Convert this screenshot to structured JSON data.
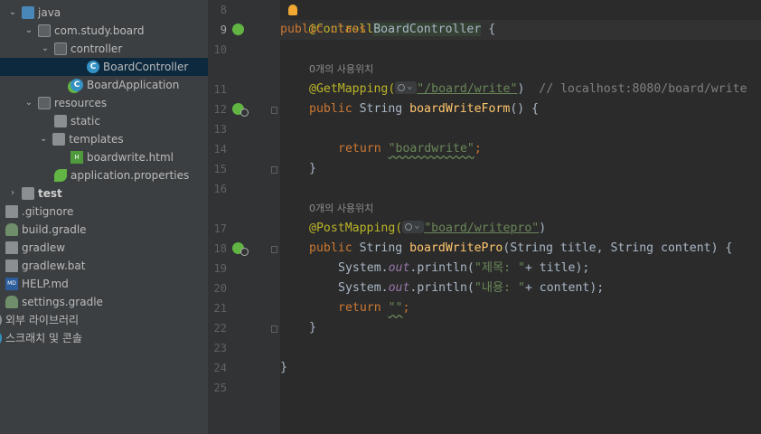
{
  "project_tree": [
    {
      "label": "java",
      "icon": "folder-icon",
      "selected": false,
      "bold": false
    },
    {
      "label": "com.study.board",
      "icon": "package-icon",
      "selected": false,
      "bold": false
    },
    {
      "label": "controller",
      "icon": "package-icon",
      "selected": false,
      "bold": false
    },
    {
      "label": "BoardController",
      "icon": "java-class-icon",
      "selected": true,
      "bold": false
    },
    {
      "label": "BoardApplication",
      "icon": "spring-boot-app-icon",
      "selected": false,
      "bold": false
    },
    {
      "label": "resources",
      "icon": "resources-folder-icon",
      "selected": false,
      "bold": false
    },
    {
      "label": "static",
      "icon": "folder-icon",
      "selected": false,
      "bold": false
    },
    {
      "label": "templates",
      "icon": "folder-icon",
      "selected": false,
      "bold": false
    },
    {
      "label": "boardwrite.html",
      "icon": "html-file-icon",
      "selected": false,
      "bold": false
    },
    {
      "label": "application.properties",
      "icon": "spring-properties-icon",
      "selected": false,
      "bold": false
    },
    {
      "label": "test",
      "icon": "folder-icon",
      "selected": false,
      "bold": true
    },
    {
      "label": ".gitignore",
      "icon": "gitignore-file-icon",
      "selected": false,
      "bold": false
    },
    {
      "label": "build.gradle",
      "icon": "gradle-icon",
      "selected": false,
      "bold": false
    },
    {
      "label": "gradlew",
      "icon": "terminal-file-icon",
      "selected": false,
      "bold": false
    },
    {
      "label": "gradlew.bat",
      "icon": "bat-file-icon",
      "selected": false,
      "bold": false
    },
    {
      "label": "HELP.md",
      "icon": "markdown-file-icon",
      "selected": false,
      "bold": false
    },
    {
      "label": "settings.gradle",
      "icon": "gradle-icon",
      "selected": false,
      "bold": false
    },
    {
      "label": "외부 라이브러리",
      "icon": "library-icon",
      "selected": false,
      "bold": false
    },
    {
      "label": "스크래치 및 콘솔",
      "icon": "scratch-icon",
      "selected": false,
      "bold": false
    }
  ],
  "editor": {
    "line_numbers": [
      "8",
      "9",
      "10",
      "11",
      "12",
      "13",
      "14",
      "15",
      "16",
      "17",
      "18",
      "19",
      "20",
      "21",
      "22",
      "23",
      "24",
      "25"
    ],
    "current_line": "9",
    "usage_hint_1": "0개의 사용위치",
    "usage_hint_2": "0개의 사용위치",
    "code": {
      "l8_ann": "@Controller",
      "l9_kw": "public class ",
      "l9_cls": "BoardController",
      "l9_rest": " {",
      "l11_ann": "@GetMapping(",
      "l11_path": "\"/board/write\"",
      "l11_close": ")",
      "l11_comment": "// localhost:8080/board/write",
      "l12_kw": "public ",
      "l12_type": "String ",
      "l12_fn": "boardWriteForm",
      "l12_rest": "() {",
      "l14_kw": "return ",
      "l14_str": "\"boardwrite\"",
      "l14_semi": ";",
      "l15_brace": "}",
      "l17_ann": "@PostMapping(",
      "l17_path": "\"board/writepro\"",
      "l17_close": ")",
      "l18_kw": "public ",
      "l18_type": "String ",
      "l18_fn": "boardWritePro",
      "l18_rest": "(String title, String content) {",
      "l19_a": "System.",
      "l19_out": "out",
      "l19_b": ".println(",
      "l19_str": "\"제목: \"",
      "l19_c": "+ title);",
      "l20_a": "System.",
      "l20_out": "out",
      "l20_b": ".println(",
      "l20_str": "\"내용: \"",
      "l20_c": "+ content);",
      "l21_kw": "return ",
      "l21_str": "\"\"",
      "l21_semi": ";",
      "l22_brace": "}",
      "l24_brace": "}"
    }
  },
  "colors": {
    "sidebar_bg": "#3c3f41",
    "editor_bg": "#2b2b2b",
    "selection_bg": "#0d293e",
    "keyword": "#cc7832",
    "annotation": "#bbb529",
    "string": "#6a8759",
    "method": "#ffc66d"
  }
}
